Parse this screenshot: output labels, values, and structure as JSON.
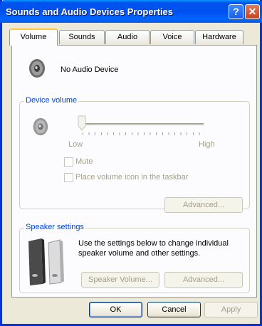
{
  "window": {
    "title": "Sounds and Audio Devices Properties"
  },
  "titlebar": {
    "help_glyph": "?",
    "close_glyph": "✕"
  },
  "tabs": [
    {
      "label": "Volume",
      "active": true
    },
    {
      "label": "Sounds",
      "active": false
    },
    {
      "label": "Audio",
      "active": false
    },
    {
      "label": "Voice",
      "active": false
    },
    {
      "label": "Hardware",
      "active": false
    }
  ],
  "device": {
    "name": "No Audio Device",
    "icon": "speaker-icon"
  },
  "device_volume": {
    "group_label": "Device volume",
    "low_label": "Low",
    "high_label": "High",
    "level": 0,
    "mute_label": "Mute",
    "taskbar_label": "Place volume icon in the taskbar",
    "advanced_label": "Advanced..."
  },
  "speaker_settings": {
    "group_label": "Speaker settings",
    "description": "Use the settings below to change individual speaker volume and other settings.",
    "speaker_volume_label": "Speaker Volume...",
    "advanced_label": "Advanced..."
  },
  "footer": {
    "ok": "OK",
    "cancel": "Cancel",
    "apply": "Apply"
  },
  "colors": {
    "titlebar": "#0050ee",
    "group_label": "#0046d5",
    "tab_highlight": "#ffc73c",
    "disabled_text": "#a3a089"
  }
}
